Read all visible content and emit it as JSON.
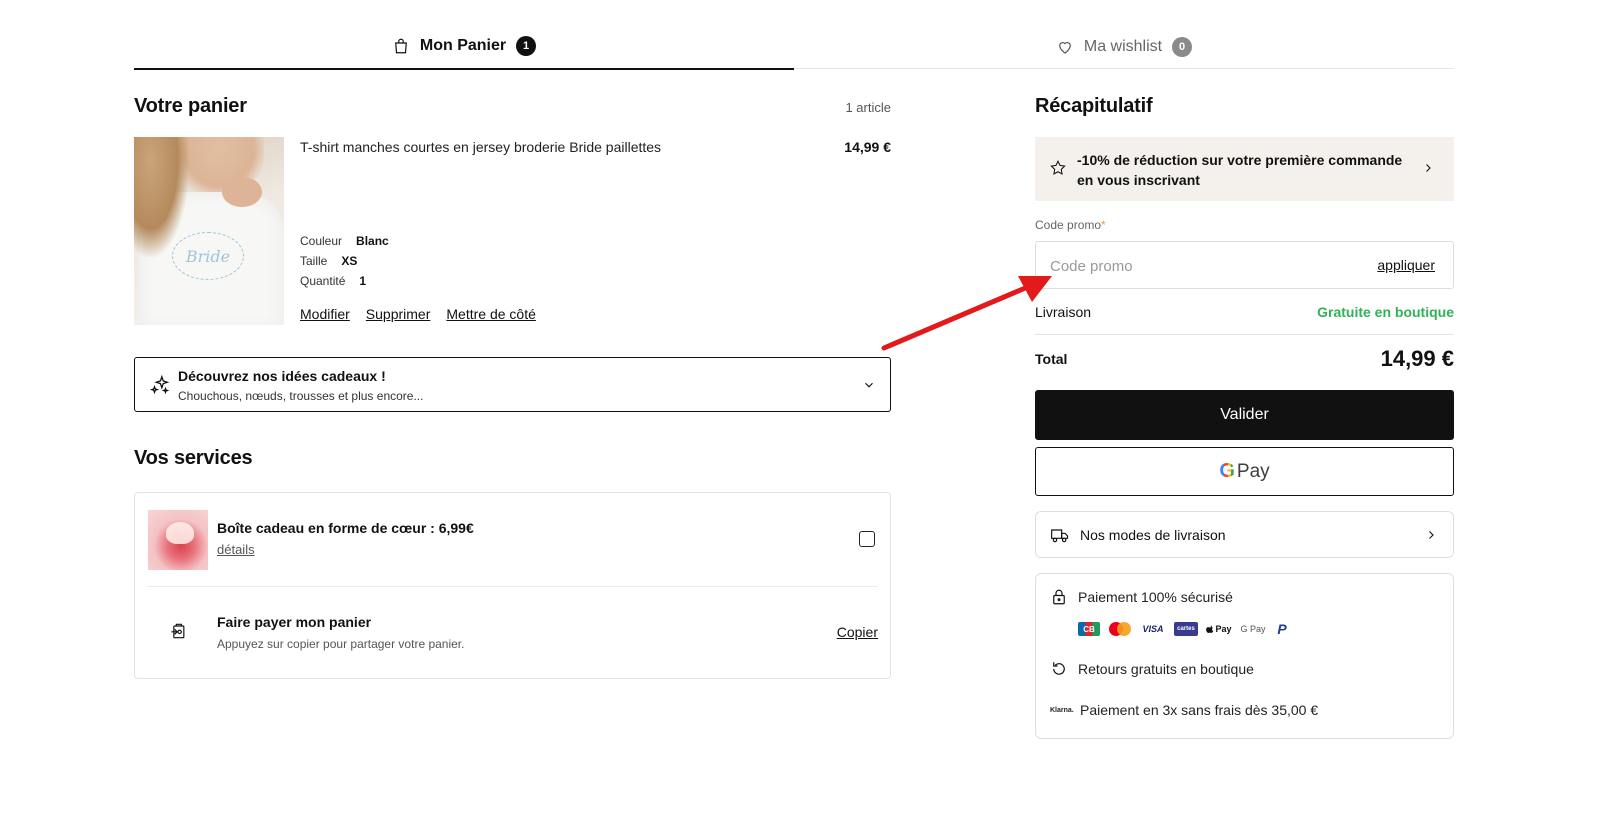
{
  "tabs": {
    "cart": {
      "label": "Mon Panier",
      "count": "1"
    },
    "wishlist": {
      "label": "Ma wishlist",
      "count": "0"
    }
  },
  "cart": {
    "title": "Votre panier",
    "count_label": "1 article",
    "item": {
      "image_text": "Bride",
      "name": "T-shirt manches courtes en jersey broderie Bride paillettes",
      "price": "14,99 €",
      "color_label": "Couleur",
      "color_value": "Blanc",
      "size_label": "Taille",
      "size_value": "XS",
      "qty_label": "Quantité",
      "qty_value": "1",
      "actions": {
        "edit": "Modifier",
        "delete": "Supprimer",
        "save_later": "Mettre de côté"
      }
    },
    "gift_ideas": {
      "title": "Découvrez nos idées cadeaux !",
      "subtitle": "Chouchous, nœuds, trousses et plus encore..."
    }
  },
  "services": {
    "title": "Vos services",
    "gift_box": {
      "title": "Boîte cadeau en forme de cœur : 6,99€",
      "link": "détails",
      "checked": false
    },
    "share": {
      "title": "Faire payer mon panier",
      "subtitle": "Appuyez sur copier pour partager votre panier.",
      "action": "Copier"
    }
  },
  "summary": {
    "title": "Récapitulatif",
    "promo_banner": "-10% de réduction sur votre première commande en vous inscrivant",
    "promo_label": "Code promo",
    "promo_required": "*",
    "promo_placeholder": "Code promo",
    "promo_apply": "appliquer",
    "delivery_label": "Livraison",
    "delivery_value": "Gratuite en boutique",
    "total_label": "Total",
    "total_value": "14,99 €",
    "validate": "Valider",
    "gpay_g": "G",
    "gpay_text": "Pay",
    "shipping_modes": "Nos modes de livraison",
    "secure_payment": "Paiement 100% sécurisé",
    "payment_logos": [
      "CB",
      "Mastercard",
      "VISA",
      "Maestro",
      "Apple Pay",
      "G Pay",
      "PayPal"
    ],
    "payment_logo_texts": {
      "cb": "CB",
      "visa": "VISA",
      "maestro": "cartes",
      "apple": "Pay",
      "gpay": "G Pay",
      "paypal": "P"
    },
    "free_returns": "Retours gratuits en boutique",
    "installments": "Paiement en 3x sans frais dès 35,00 €",
    "klarna": "Klarna."
  },
  "colors": {
    "accent_green": "#2eb356",
    "dark": "#111111",
    "promo_bg": "#f4f1ec",
    "annotation_red": "#e3191c"
  }
}
